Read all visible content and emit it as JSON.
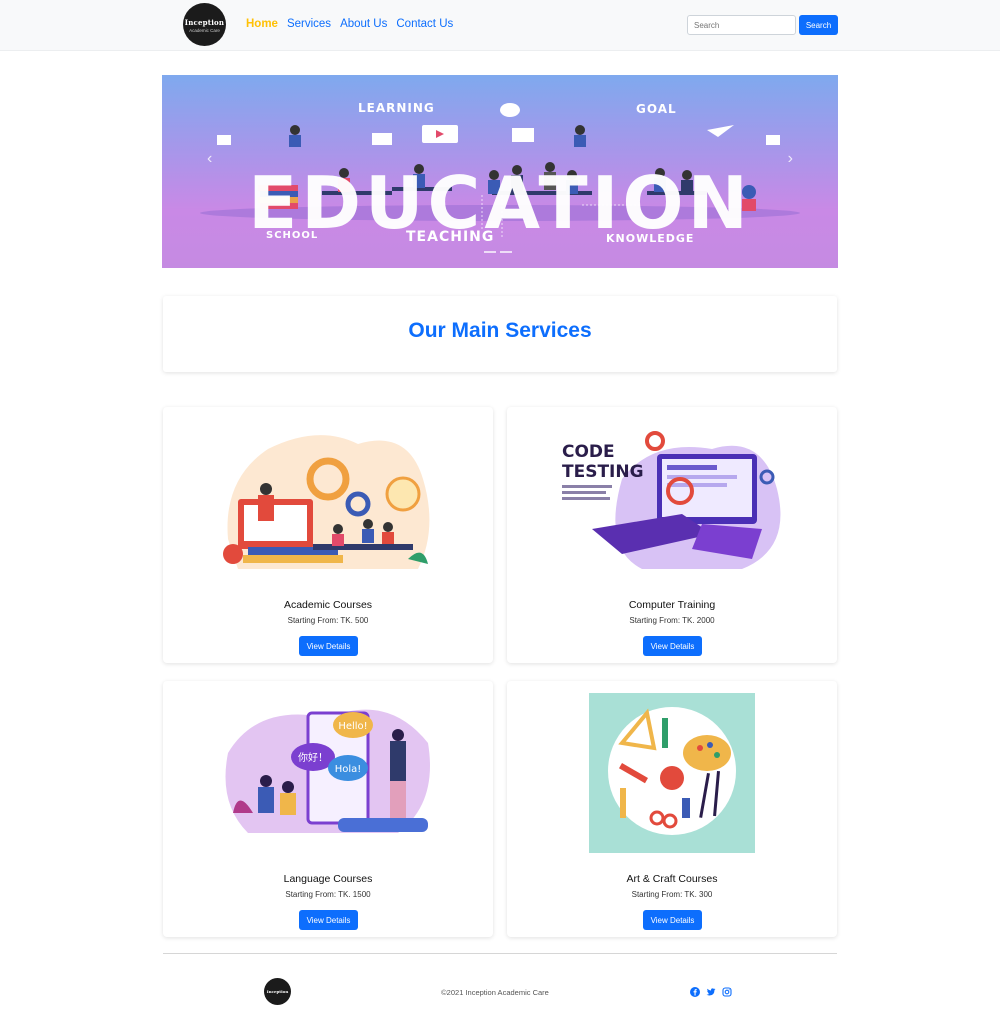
{
  "brand": {
    "name": "Inception",
    "tagline": "Academic Care"
  },
  "nav": {
    "links": [
      {
        "label": "Home",
        "active": true
      },
      {
        "label": "Services",
        "active": false
      },
      {
        "label": "About Us",
        "active": false
      },
      {
        "label": "Contact Us",
        "active": false
      }
    ],
    "search_placeholder": "Search",
    "search_button": "Search"
  },
  "hero": {
    "headline": "EDUCATION",
    "labels": {
      "learning": "LEARNING",
      "goal": "GOAL",
      "school": "SCHOOL",
      "teaching": "TEACHING",
      "knowledge": "KNOWLEDGE"
    }
  },
  "section": {
    "title": "Our Main Services"
  },
  "services": [
    {
      "title": "Academic Courses",
      "price": "Starting From: TK. 500",
      "button": "View Details",
      "image": "academic-illustration"
    },
    {
      "title": "Computer Training",
      "price": "Starting From: TK. 2000",
      "button": "View Details",
      "image": "code-testing-illustration",
      "image_text": [
        "CODE",
        "TESTING"
      ]
    },
    {
      "title": "Language Courses",
      "price": "Starting From: TK. 1500",
      "button": "View Details",
      "image": "language-illustration",
      "image_text": [
        "Hello!",
        "你好！",
        "Hola!"
      ]
    },
    {
      "title": "Art & Craft Courses",
      "price": "Starting From: TK. 300",
      "button": "View Details",
      "image": "art-palette-illustration"
    }
  ],
  "footer": {
    "logo_text": "Inception",
    "copyright": "©2021 Inception Academic Care",
    "social_icons": [
      "facebook-icon",
      "twitter-icon",
      "instagram-icon"
    ]
  },
  "colors": {
    "primary": "#0d6efd",
    "active_link": "#ffc107",
    "navbar_bg": "#f8f9fa"
  }
}
